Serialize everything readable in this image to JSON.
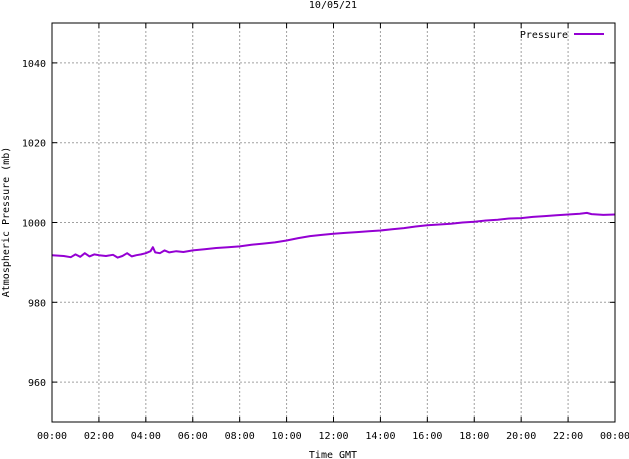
{
  "chart_data": {
    "type": "line",
    "title": "10/05/21",
    "xlabel": "Time GMT",
    "ylabel": "Atmospheric Pressure (mb)",
    "ylim": [
      950,
      1050
    ],
    "xlim": [
      0,
      24
    ],
    "x_unit": "hours GMT",
    "x_ticks": [
      0,
      2,
      4,
      6,
      8,
      10,
      12,
      14,
      16,
      18,
      20,
      22,
      24
    ],
    "x_tick_labels": [
      "00:00",
      "02:00",
      "04:00",
      "06:00",
      "08:00",
      "10:00",
      "12:00",
      "14:00",
      "16:00",
      "18:00",
      "20:00",
      "22:00",
      "00:00"
    ],
    "y_ticks": [
      960,
      980,
      1000,
      1020,
      1040
    ],
    "y_tick_labels": [
      "960",
      "980",
      "1000",
      "1020",
      "1040"
    ],
    "grid": true,
    "legend": "top-right",
    "series": [
      {
        "name": "Pressure",
        "color": "#9400d3",
        "x": [
          0,
          0.5,
          0.8,
          1.0,
          1.2,
          1.4,
          1.6,
          1.8,
          2.0,
          2.3,
          2.6,
          2.8,
          3.0,
          3.2,
          3.4,
          3.6,
          3.8,
          4.0,
          4.2,
          4.3,
          4.4,
          4.6,
          4.8,
          5.0,
          5.3,
          5.6,
          6.0,
          6.5,
          7.0,
          7.5,
          8.0,
          8.5,
          9.0,
          9.5,
          10.0,
          10.5,
          11.0,
          11.5,
          12.0,
          12.5,
          13.0,
          13.5,
          14.0,
          14.5,
          15.0,
          15.5,
          16.0,
          16.5,
          17.0,
          17.5,
          18.0,
          18.5,
          19.0,
          19.5,
          20.0,
          20.5,
          21.0,
          21.5,
          22.0,
          22.5,
          22.8,
          23.0,
          23.5,
          24.0
        ],
        "y": [
          991.8,
          991.6,
          991.3,
          992.0,
          991.4,
          992.3,
          991.5,
          992.0,
          991.8,
          991.6,
          991.9,
          991.2,
          991.6,
          992.3,
          991.5,
          991.8,
          992.0,
          992.3,
          992.8,
          993.8,
          992.5,
          992.3,
          993.0,
          992.5,
          992.8,
          992.6,
          993.0,
          993.3,
          993.6,
          993.8,
          994.0,
          994.4,
          994.7,
          995.0,
          995.5,
          996.1,
          996.6,
          996.9,
          997.2,
          997.4,
          997.6,
          997.8,
          998.0,
          998.3,
          998.6,
          999.0,
          999.3,
          999.5,
          999.7,
          1000.0,
          1000.2,
          1000.5,
          1000.7,
          1001.0,
          1001.1,
          1001.4,
          1001.6,
          1001.8,
          1002.0,
          1002.2,
          1002.4,
          1002.1,
          1001.9,
          1002.0
        ]
      }
    ]
  }
}
